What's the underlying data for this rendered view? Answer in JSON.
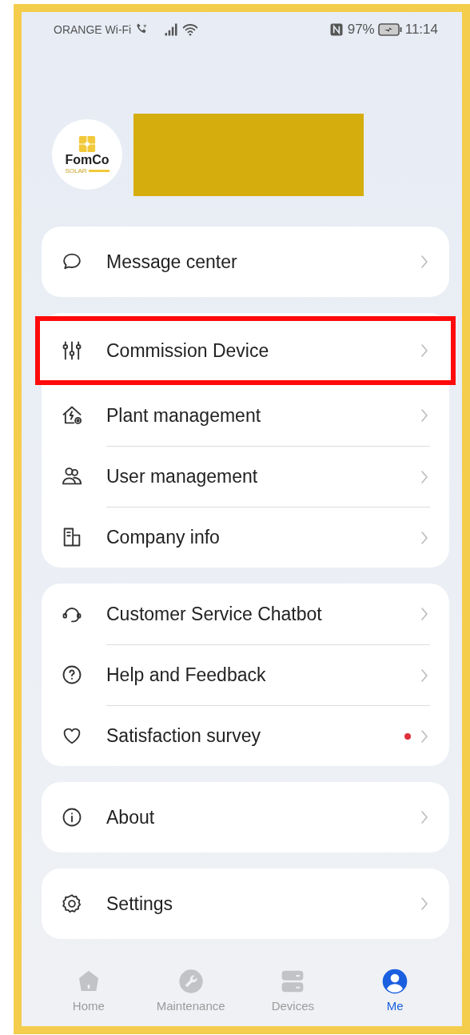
{
  "status_bar": {
    "carrier": "ORANGE Wi-Fi",
    "battery": "97%",
    "time": "11:14"
  },
  "profile": {
    "logo_text": "FomCo",
    "logo_subtext": "SOLAR",
    "name_redacted": true
  },
  "menu_groups": [
    {
      "items": [
        {
          "label": "Message center",
          "highlighted": false,
          "badge": false
        }
      ]
    },
    {
      "items": [
        {
          "label": "Commission Device",
          "highlighted": true,
          "badge": false
        },
        {
          "label": "Plant management",
          "highlighted": false,
          "badge": false
        },
        {
          "label": "User management",
          "highlighted": false,
          "badge": false
        },
        {
          "label": "Company info",
          "highlighted": false,
          "badge": false
        }
      ]
    },
    {
      "items": [
        {
          "label": "Customer Service Chatbot",
          "highlighted": false,
          "badge": false
        },
        {
          "label": "Help and Feedback",
          "highlighted": false,
          "badge": false
        },
        {
          "label": "Satisfaction survey",
          "highlighted": false,
          "badge": true
        }
      ]
    },
    {
      "items": [
        {
          "label": "About",
          "highlighted": false,
          "badge": false
        }
      ]
    },
    {
      "items": [
        {
          "label": "Settings",
          "highlighted": false,
          "badge": false
        }
      ]
    }
  ],
  "tab_bar": [
    {
      "label": "Home",
      "selected": false
    },
    {
      "label": "Maintenance",
      "selected": false
    },
    {
      "label": "Devices",
      "selected": false
    },
    {
      "label": "Me",
      "selected": true
    }
  ]
}
